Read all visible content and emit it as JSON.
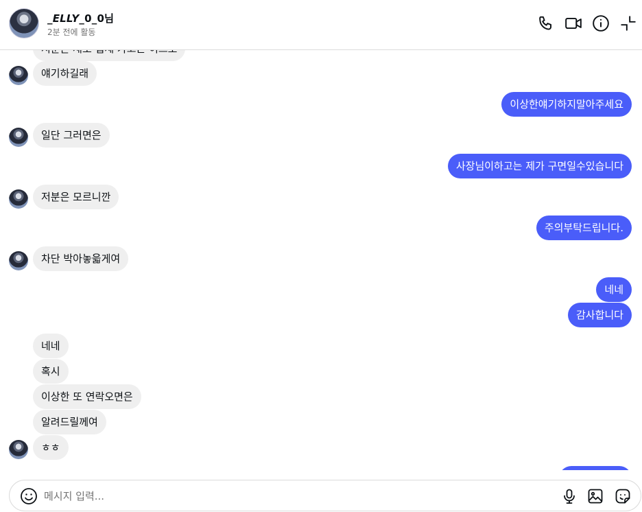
{
  "header": {
    "title_prefix": "_",
    "title_italic": "ELLY",
    "title_suffix": "_0_0님",
    "status": "2분 전에 활동",
    "icons": [
      "phone-icon",
      "video-icon",
      "info-icon",
      "minimize-icon"
    ]
  },
  "messages": [
    {
      "dir": "in",
      "text": "저분은 새로 업체 가고는 이으로"
    },
    {
      "dir": "in",
      "text": "얘기하길래"
    },
    {
      "dir": "out",
      "text": "이상한얘기하지말아주세요"
    },
    {
      "dir": "in",
      "text": "일단 그러면은"
    },
    {
      "dir": "out",
      "text": "사장님이하고는 제가 구면일수있습니다"
    },
    {
      "dir": "in",
      "text": "저분은 모르니깐"
    },
    {
      "dir": "out",
      "text": "주의부탁드립니다."
    },
    {
      "dir": "in",
      "text": "차단 박아놓읇게여"
    },
    {
      "dir": "out",
      "text": "네네"
    },
    {
      "dir": "out",
      "text": "감사합니다"
    },
    {
      "dir": "in",
      "text": "네네"
    },
    {
      "dir": "in",
      "text": "혹시"
    },
    {
      "dir": "in",
      "text": "이상한 또 연락오면은"
    },
    {
      "dir": "in",
      "text": "알려드릴께여"
    },
    {
      "dir": "in",
      "text": "ㅎㅎ"
    }
  ],
  "composer": {
    "placeholder": "메시지 입력...",
    "icons": [
      "emoji-icon",
      "microphone-icon",
      "image-icon",
      "sticker-icon"
    ]
  },
  "colors": {
    "outgoing": "#4a5df9",
    "incoming": "#efefef"
  }
}
